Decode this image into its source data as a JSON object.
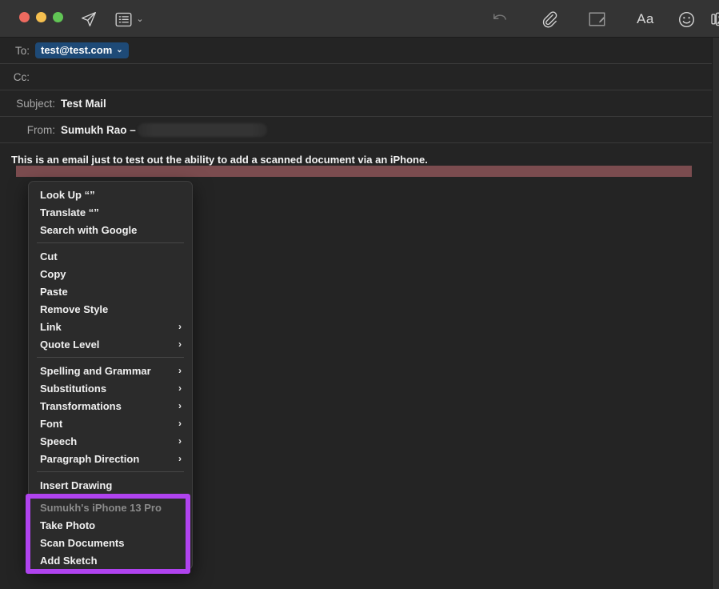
{
  "window": {
    "traffic_lights": [
      "close",
      "minimize",
      "zoom"
    ],
    "accent_highlight": "#b043ef",
    "selection_bar_color": "#7b4c4f",
    "token_color": "#1e4a77"
  },
  "toolbar": {
    "items": [
      {
        "name": "send-button",
        "icon": "send-icon",
        "label": "Send"
      },
      {
        "name": "stationery-button",
        "icon": "stationery-icon",
        "label": "Stationery",
        "chevron": "⌄"
      },
      {
        "name": "undo-button",
        "icon": "undo-icon",
        "label": "Undo"
      },
      {
        "name": "attach-button",
        "icon": "paperclip-icon",
        "label": "Attach"
      },
      {
        "name": "markup-button",
        "icon": "markup-icon",
        "label": "Markup"
      },
      {
        "name": "format-button",
        "icon": "format-aa-icon",
        "label": "Aa"
      },
      {
        "name": "emoji-button",
        "icon": "emoji-icon",
        "label": "Emoji"
      },
      {
        "name": "photos-button",
        "icon": "photo-browser-icon",
        "label": "Photos",
        "chevron": "⌄"
      }
    ]
  },
  "header": {
    "to": {
      "label": "To:",
      "token": "test@test.com",
      "token_chevron": "⌄"
    },
    "cc": {
      "label": "Cc:",
      "value": ""
    },
    "subject": {
      "label": "Subject:",
      "value": "Test Mail"
    },
    "from": {
      "label": "From:",
      "value": "Sumukh Rao –",
      "redacted": true
    }
  },
  "body": {
    "text": "This is an email just to test out the ability to add a scanned document via an iPhone."
  },
  "context_menu": {
    "groups": [
      {
        "items": [
          {
            "label": "Look Up “”",
            "submenu": false
          },
          {
            "label": "Translate “”",
            "submenu": false
          },
          {
            "label": "Search with Google",
            "submenu": false
          }
        ]
      },
      {
        "items": [
          {
            "label": "Cut",
            "submenu": false
          },
          {
            "label": "Copy",
            "submenu": false
          },
          {
            "label": "Paste",
            "submenu": false
          },
          {
            "label": "Remove Style",
            "submenu": false
          },
          {
            "label": "Link",
            "submenu": true,
            "arrow": "›"
          },
          {
            "label": "Quote Level",
            "submenu": true,
            "arrow": "›"
          }
        ]
      },
      {
        "items": [
          {
            "label": "Spelling and Grammar",
            "submenu": true,
            "arrow": "›"
          },
          {
            "label": "Substitutions",
            "submenu": true,
            "arrow": "›"
          },
          {
            "label": "Transformations",
            "submenu": true,
            "arrow": "›"
          },
          {
            "label": "Font",
            "submenu": true,
            "arrow": "›"
          },
          {
            "label": "Speech",
            "submenu": true,
            "arrow": "›"
          },
          {
            "label": "Paragraph Direction",
            "submenu": true,
            "arrow": "›"
          }
        ]
      },
      {
        "items": [
          {
            "label": "Insert Drawing",
            "submenu": false
          }
        ]
      },
      {
        "highlighted": true,
        "items": [
          {
            "label": "Sumukh's iPhone 13 Pro",
            "disabled": true
          },
          {
            "label": "Take Photo",
            "submenu": false
          },
          {
            "label": "Scan Documents",
            "submenu": false
          },
          {
            "label": "Add Sketch",
            "submenu": false
          }
        ]
      }
    ]
  }
}
